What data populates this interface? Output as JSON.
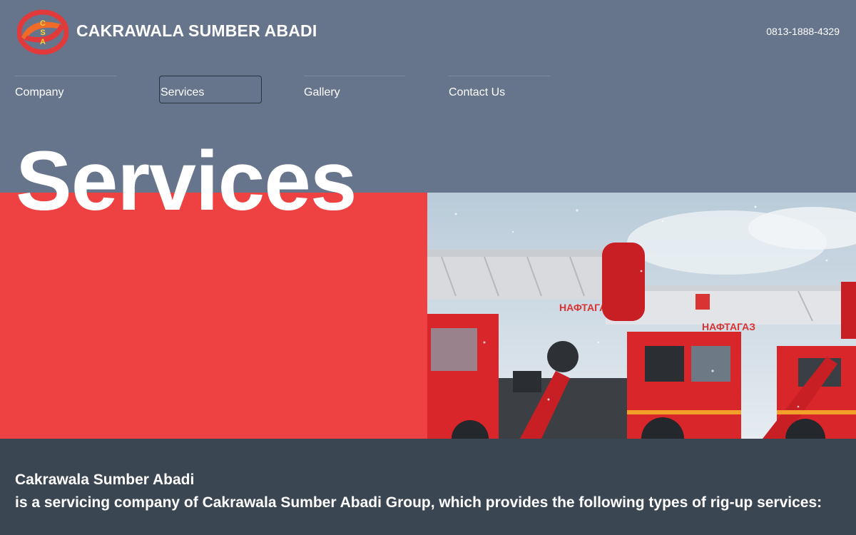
{
  "header": {
    "logo_letters": [
      "C",
      "S",
      "A"
    ],
    "brand_name": "CAKRAWALA SUMBER ABADI",
    "phone": "0813-1888-4329"
  },
  "nav": {
    "items": [
      {
        "label": "Company",
        "active": false
      },
      {
        "label": "Services",
        "active": true
      },
      {
        "label": "Gallery",
        "active": false
      },
      {
        "label": "Contact Us",
        "active": false
      }
    ]
  },
  "hero": {
    "title": "Services",
    "image_description": "red crane trucks in snow"
  },
  "intro": {
    "company_name": "Cakrawala Sumber Abadi",
    "description": "is a servicing company of Cakrawala Sumber Abadi Group, which provides the following types of rig-up services:"
  },
  "colors": {
    "top_band": "#66758c",
    "accent_red": "#ee4242",
    "bottom_band": "#3b4653",
    "text": "#ffffff"
  }
}
